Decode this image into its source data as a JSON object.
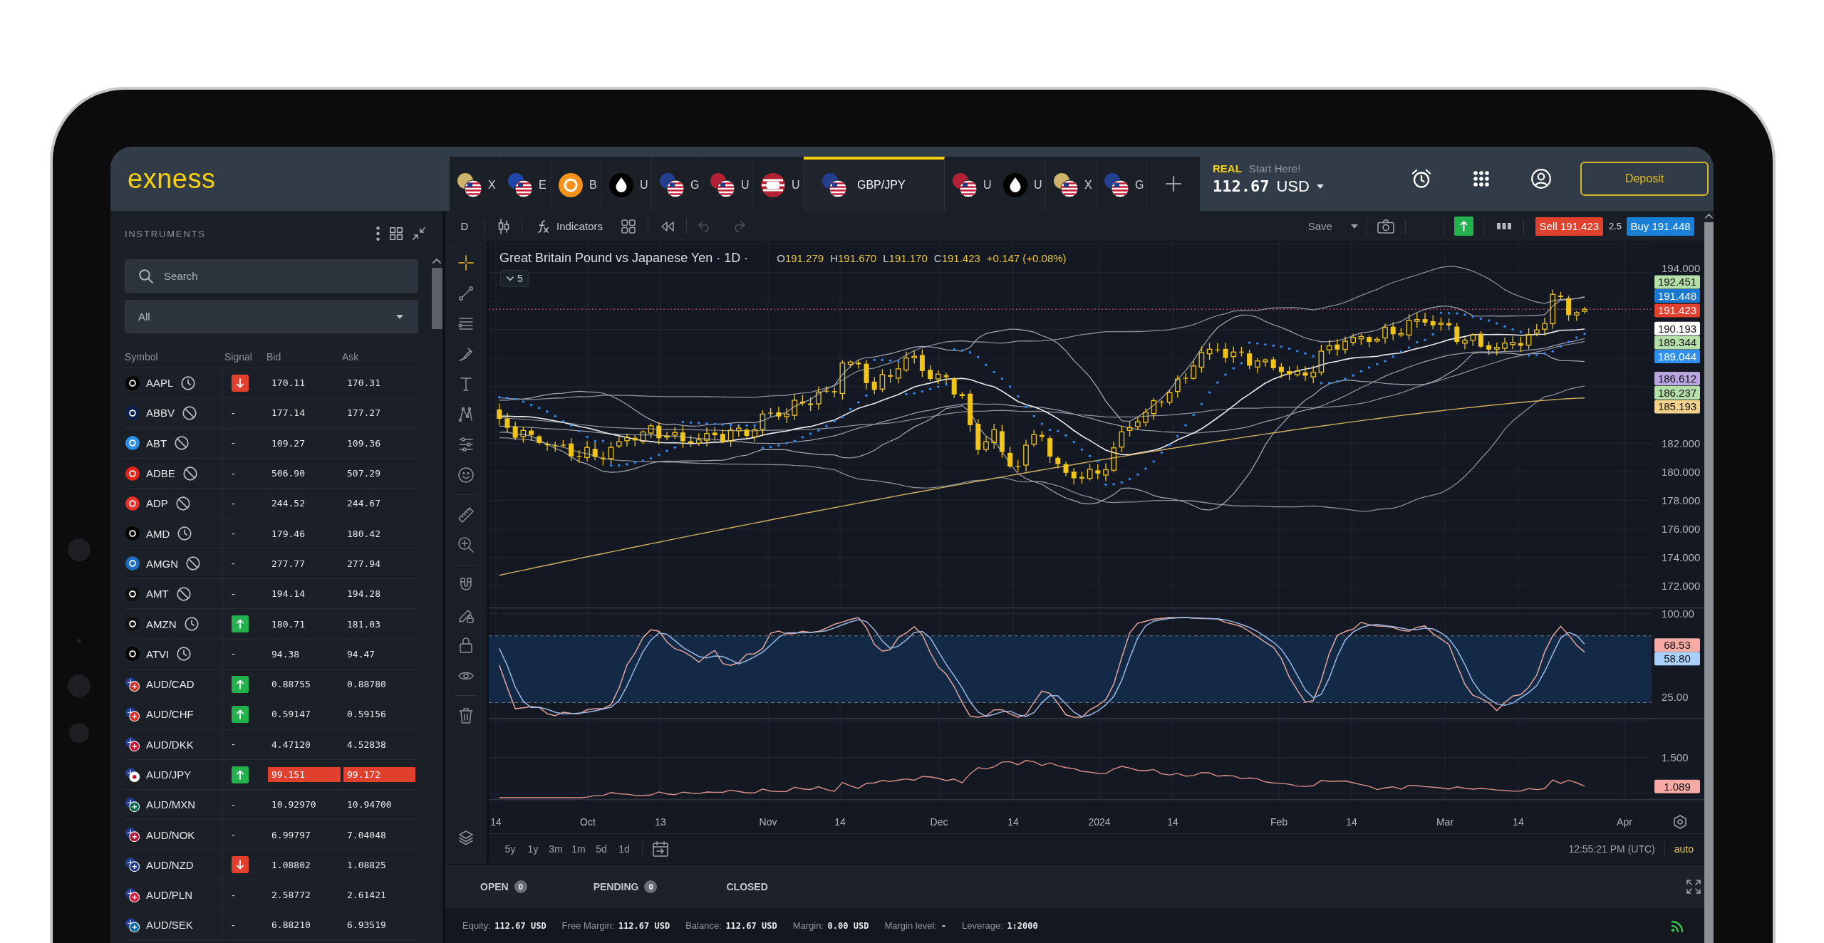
{
  "header": {
    "logo": "exness",
    "tabs": [
      {
        "label": "X",
        "kind": "pair",
        "color": "#cdb36b",
        "selected": false
      },
      {
        "label": "E",
        "kind": "pair",
        "color": "#1f47a8",
        "selected": false
      },
      {
        "label": "B",
        "kind": "coin",
        "color": "#f7931a",
        "selected": false
      },
      {
        "label": "U",
        "kind": "drop",
        "color": "#000000",
        "selected": false
      },
      {
        "label": "G",
        "kind": "pair",
        "color": "#243f8f",
        "selected": false
      },
      {
        "label": "U",
        "kind": "pair",
        "color": "#b22234",
        "selected": false
      },
      {
        "label": "U",
        "kind": "index",
        "color": "#b22234",
        "selected": false
      },
      {
        "label": "GBP/JPY",
        "kind": "pair",
        "color": "#243f8f",
        "selected": true
      },
      {
        "label": "U",
        "kind": "pair",
        "color": "#b22234",
        "selected": false
      },
      {
        "label": "U",
        "kind": "drop",
        "color": "#000000",
        "selected": false
      },
      {
        "label": "X",
        "kind": "pair",
        "color": "#cdb36b",
        "selected": false
      },
      {
        "label": "G",
        "kind": "pair",
        "color": "#243f8f",
        "selected": false
      }
    ],
    "account": {
      "mode": "REAL",
      "hint": "Start Here!",
      "balance": "112.67",
      "currency": "USD"
    },
    "deposit_button": "Deposit"
  },
  "sidebar": {
    "title": "INSTRUMENTS",
    "search": {
      "placeholder": "Search"
    },
    "filter": {
      "value": "All"
    },
    "columns": [
      "Symbol",
      "Signal",
      "Bid",
      "Ask"
    ],
    "rows": [
      {
        "symbol": "AAPL",
        "kind": "stock",
        "color": "#000000",
        "market_closed": true,
        "trading_disabled": false,
        "signal": {
          "kind": "down"
        },
        "bid": "170.11",
        "ask": "170.31",
        "price_fell": false
      },
      {
        "symbol": "ABBV",
        "kind": "stock",
        "color": "#0b1f4b",
        "market_closed": false,
        "trading_disabled": true,
        "signal": {
          "kind": "none",
          "label": "-"
        },
        "bid": "177.14",
        "ask": "177.27",
        "price_fell": false
      },
      {
        "symbol": "ABT",
        "kind": "stock",
        "color": "#2d8fe6",
        "market_closed": false,
        "trading_disabled": true,
        "signal": {
          "kind": "none",
          "label": "-"
        },
        "bid": "109.27",
        "ask": "109.36",
        "price_fell": false
      },
      {
        "symbol": "ADBE",
        "kind": "stock",
        "color": "#e32519",
        "market_closed": false,
        "trading_disabled": true,
        "signal": {
          "kind": "none",
          "label": "-"
        },
        "bid": "506.90",
        "ask": "507.29",
        "price_fell": false
      },
      {
        "symbol": "ADP",
        "kind": "stock",
        "color": "#e4322b",
        "market_closed": false,
        "trading_disabled": true,
        "signal": {
          "kind": "none",
          "label": "-"
        },
        "bid": "244.52",
        "ask": "244.67",
        "price_fell": false
      },
      {
        "symbol": "AMD",
        "kind": "stock",
        "color": "#000000",
        "market_closed": true,
        "trading_disabled": false,
        "signal": {
          "kind": "none",
          "label": "-"
        },
        "bid": "179.46",
        "ask": "180.42",
        "price_fell": false
      },
      {
        "symbol": "AMGN",
        "kind": "stock",
        "color": "#1e6bc0",
        "market_closed": false,
        "trading_disabled": true,
        "signal": {
          "kind": "none",
          "label": "-"
        },
        "bid": "277.77",
        "ask": "277.94",
        "price_fell": false
      },
      {
        "symbol": "AMT",
        "kind": "stock",
        "color": "#111111",
        "market_closed": false,
        "trading_disabled": true,
        "signal": {
          "kind": "none",
          "label": "-"
        },
        "bid": "194.14",
        "ask": "194.28",
        "price_fell": false
      },
      {
        "symbol": "AMZN",
        "kind": "stock",
        "color": "#111111",
        "market_closed": true,
        "trading_disabled": false,
        "signal": {
          "kind": "up"
        },
        "bid": "180.71",
        "ask": "181.03",
        "price_fell": false
      },
      {
        "symbol": "ATVI",
        "kind": "stock",
        "color": "#000000",
        "market_closed": true,
        "trading_disabled": false,
        "signal": {
          "kind": "none",
          "label": "-"
        },
        "bid": "94.38",
        "ask": "94.47",
        "price_fell": false
      },
      {
        "symbol": "AUD/CAD",
        "kind": "pair",
        "color": "#d52b1e",
        "market_closed": false,
        "trading_disabled": false,
        "signal": {
          "kind": "up"
        },
        "bid": "0.88755",
        "ask": "0.88780",
        "price_fell": false
      },
      {
        "symbol": "AUD/CHF",
        "kind": "pair",
        "color": "#da291c",
        "market_closed": false,
        "trading_disabled": false,
        "signal": {
          "kind": "up"
        },
        "bid": "0.59147",
        "ask": "0.59156",
        "price_fell": false
      },
      {
        "symbol": "AUD/DKK",
        "kind": "pair",
        "color": "#c8102e",
        "market_closed": false,
        "trading_disabled": false,
        "signal": {
          "kind": "none",
          "label": "-"
        },
        "bid": "4.47120",
        "ask": "4.52838",
        "price_fell": false
      },
      {
        "symbol": "AUD/JPY",
        "kind": "pair",
        "color": "#ffffff",
        "market_closed": false,
        "trading_disabled": false,
        "signal": {
          "kind": "up"
        },
        "bid": "99.151",
        "ask": "99.172",
        "price_fell": true
      },
      {
        "symbol": "AUD/MXN",
        "kind": "pair",
        "color": "#006847",
        "market_closed": false,
        "trading_disabled": false,
        "signal": {
          "kind": "none",
          "label": "-"
        },
        "bid": "10.92970",
        "ask": "10.94700",
        "price_fell": false
      },
      {
        "symbol": "AUD/NOK",
        "kind": "pair",
        "color": "#ba0c2f",
        "market_closed": false,
        "trading_disabled": false,
        "signal": {
          "kind": "none",
          "label": "-"
        },
        "bid": "6.99797",
        "ask": "7.04048",
        "price_fell": false
      },
      {
        "symbol": "AUD/NZD",
        "kind": "pair",
        "color": "#1f3a8a",
        "market_closed": false,
        "trading_disabled": false,
        "signal": {
          "kind": "down"
        },
        "bid": "1.08802",
        "ask": "1.08825",
        "price_fell": false
      },
      {
        "symbol": "AUD/PLN",
        "kind": "pair",
        "color": "#dc143c",
        "market_closed": false,
        "trading_disabled": false,
        "signal": {
          "kind": "none",
          "label": "-"
        },
        "bid": "2.58772",
        "ask": "2.61421",
        "price_fell": false
      },
      {
        "symbol": "AUD/SEK",
        "kind": "pair",
        "color": "#006aa7",
        "market_closed": false,
        "trading_disabled": false,
        "signal": {
          "kind": "none",
          "label": "-"
        },
        "bid": "6.88210",
        "ask": "6.93519",
        "price_fell": false
      }
    ]
  },
  "chart_toolbar": {
    "interval": "D",
    "indicators_button": "Indicators",
    "history": [
      {
        "kind": "undo",
        "disabled": true
      },
      {
        "kind": "redo",
        "disabled": true
      }
    ],
    "save_button": "Save",
    "sell": {
      "label": "Sell",
      "price": "191.423"
    },
    "spread": "2.5",
    "buy": {
      "label": "Buy",
      "price": "191.448"
    }
  },
  "drawing_tools": [
    {
      "tools": [
        {
          "kind": "crosshair",
          "selected": true
        },
        {
          "kind": "trendline",
          "selected": false
        },
        {
          "kind": "fib",
          "selected": false
        },
        {
          "kind": "brush",
          "selected": false
        },
        {
          "kind": "text",
          "selected": false
        },
        {
          "kind": "pattern",
          "selected": false
        },
        {
          "kind": "forecast",
          "selected": false
        },
        {
          "kind": "emoji",
          "selected": false
        }
      ]
    },
    {
      "tools": [
        {
          "kind": "ruler",
          "selected": false
        },
        {
          "kind": "zoom",
          "selected": false
        }
      ]
    },
    {
      "tools": [
        {
          "kind": "magnet",
          "selected": false
        },
        {
          "kind": "drawlock",
          "selected": false
        },
        {
          "kind": "lock",
          "selected": false
        },
        {
          "kind": "visibility",
          "selected": false
        }
      ]
    },
    {
      "tools": [
        {
          "kind": "trash",
          "selected": false
        }
      ]
    }
  ],
  "chart": {
    "title": "Great Britain Pound vs Japanese Yen · 1D ·",
    "ohlc": [
      {
        "key": "O",
        "value": "191.279"
      },
      {
        "key": "H",
        "value": "191.670"
      },
      {
        "key": "L",
        "value": "191.170"
      },
      {
        "key": "C",
        "value": "191.423"
      }
    ],
    "change": "+0.147 (+0.08%)",
    "indicators_toggle": "5",
    "price_ticks": [
      "194.000",
      "182.000",
      "180.000",
      "178.000",
      "176.000",
      "174.000",
      "172.000"
    ],
    "price_tags": [
      {
        "text": "192.451",
        "color": "#b5dfa8"
      },
      {
        "text": "191.448",
        "color": "#1a78d0"
      },
      {
        "text": "191.423",
        "color": "#e2412f"
      },
      {
        "text": "190.193",
        "color": "#ffffff"
      },
      {
        "text": "189.344",
        "color": "#b5dfa8"
      },
      {
        "text": "189.044",
        "color": "#2f8fef"
      },
      {
        "text": "186.612",
        "color": "#b9a6e0"
      },
      {
        "text": "186.237",
        "color": "#b5dfa8"
      },
      {
        "text": "185.193",
        "color": "#f3d38b"
      }
    ],
    "oscillator_ticks": [
      "100.00",
      "25.00"
    ],
    "oscillator_tags": [
      {
        "text": "68.53",
        "color": "#f7a9a3"
      },
      {
        "text": "58.80",
        "color": "#a9cffb"
      }
    ],
    "volatility_ticks": [
      "1.500"
    ],
    "volatility_tags": [
      {
        "text": "1.089",
        "color": "#f7a9a3"
      }
    ],
    "time_labels": [
      "14",
      "Oct",
      "13",
      "Nov",
      "14",
      "Dec",
      "14",
      "2024",
      "14",
      "Feb",
      "14",
      "Mar",
      "14",
      "Apr"
    ]
  },
  "range_bar": {
    "ranges": [
      "5y",
      "1y",
      "3m",
      "1m",
      "5d",
      "1d"
    ],
    "clock": "12:55:21 PM (UTC)",
    "scale_mode": "auto"
  },
  "trades_panel": {
    "tabs": [
      {
        "label": "OPEN",
        "count": "0",
        "selected": false
      },
      {
        "label": "PENDING",
        "count": "0",
        "selected": false
      },
      {
        "label": "CLOSED",
        "selected": false
      }
    ]
  },
  "status_bar": [
    "Equity: **112.67 USD**",
    "Free Margin: **112.67 USD**",
    "Balance: **112.67 USD**",
    "Margin: **0.00 USD**",
    "Margin level: **-**",
    "Leverage: **1:2000**"
  ]
}
